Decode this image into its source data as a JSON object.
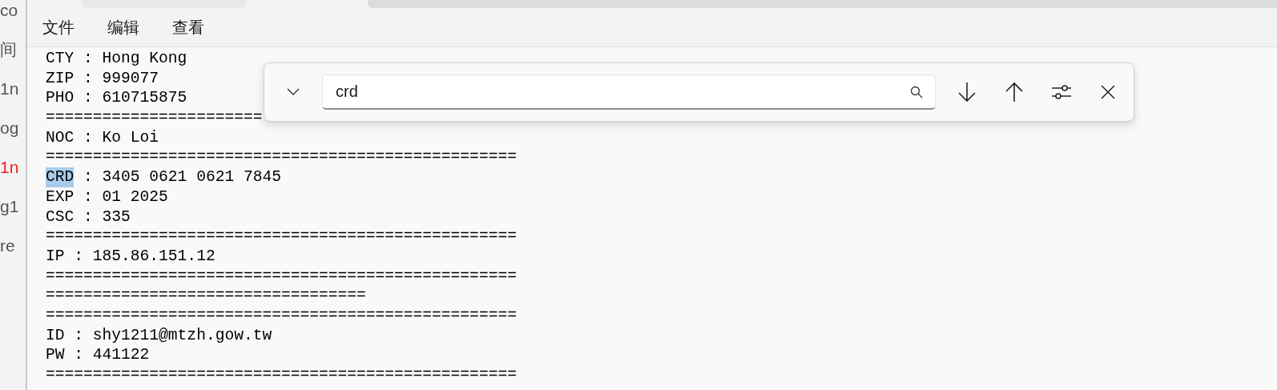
{
  "background_window": {
    "texts": [
      {
        "text": "co",
        "color": "#555555"
      },
      {
        "text": "间",
        "color": "#555555"
      },
      {
        "text": "1n",
        "color": "#555555"
      },
      {
        "text": "og",
        "color": "#555555"
      },
      {
        "text": "1n",
        "color": "#ee2222"
      },
      {
        "text": "g1",
        "color": "#555555"
      },
      {
        "text": "re",
        "color": "#555555"
      }
    ]
  },
  "menu": [
    "文件",
    "编辑",
    "查看"
  ],
  "document": {
    "lines": [
      {
        "text": "CTY : Hong Kong"
      },
      {
        "text": "ZIP : 999077"
      },
      {
        "text": "PHO : 610715875"
      },
      {
        "text": "======================="
      },
      {
        "text": "NOC : Ko Loi"
      },
      {
        "text": "=================================================="
      },
      {
        "match": "CRD",
        "text": " : 3405 0621 0621 7845"
      },
      {
        "text": "EXP : 01 2025"
      },
      {
        "text": "CSC : 335"
      },
      {
        "text": "=================================================="
      },
      {
        "text": "IP : 185.86.151.12"
      },
      {
        "text": "=================================================="
      },
      {
        "text": "=================================="
      },
      {
        "text": "=================================================="
      },
      {
        "text": "ID : shy1211@mtzh.gow.tw"
      },
      {
        "text": "PW : 441122"
      },
      {
        "text": "=================================================="
      }
    ]
  },
  "find_bar": {
    "query": "crd"
  }
}
